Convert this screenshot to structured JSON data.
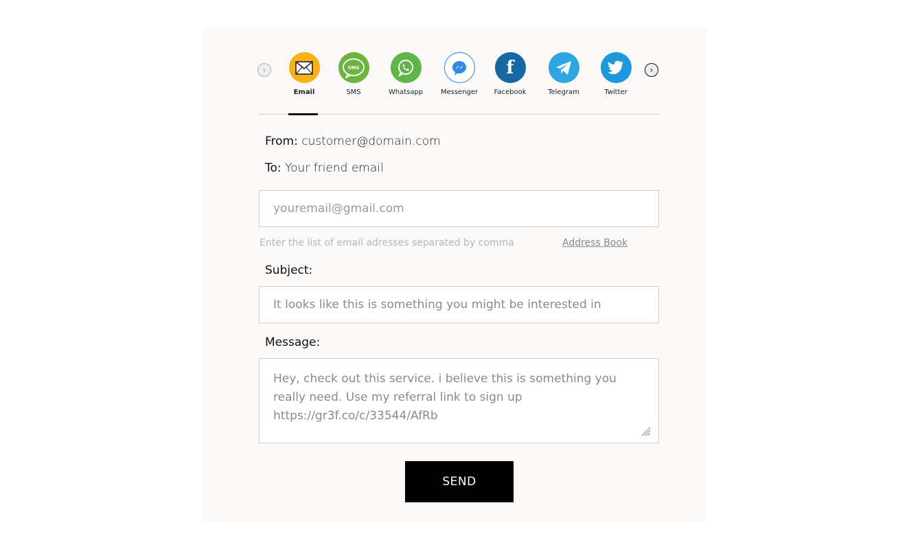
{
  "share": {
    "channels": [
      {
        "label": "Email",
        "icon": "envelope-icon",
        "color": "#fbb116",
        "active": true
      },
      {
        "label": "SMS",
        "icon": "sms-bubble-icon",
        "color": "#6cb33f",
        "badge": "SMS"
      },
      {
        "label": "Whatsapp",
        "icon": "whatsapp-icon",
        "color": "#5fb548"
      },
      {
        "label": "Messenger",
        "icon": "messenger-icon",
        "color": "#ffffff"
      },
      {
        "label": "Facebook",
        "icon": "facebook-icon",
        "color": "#1568a3",
        "glyph": "f"
      },
      {
        "label": "Telegram",
        "icon": "telegram-icon",
        "color": "#2fa6e0"
      },
      {
        "label": "Twitter",
        "icon": "twitter-icon",
        "color": "#1d98dc"
      }
    ],
    "prev_icon": "‹",
    "next_icon": "›"
  },
  "form": {
    "from_label": "From:",
    "from_value": "customer@domain.com",
    "to_label": "To:",
    "to_value": "Your friend email",
    "recipients_placeholder": "youremail@gmail.com",
    "hint": "Enter the list of email adresses separated by comma",
    "address_book_link": "Address Book",
    "subject_label": "Subject:",
    "subject_value": "It looks like this is something you might be interested in",
    "message_label": "Message:",
    "message_value": "Hey, check out this service. i believe this is something you\nreally need. Use my referral link to sign up\nhttps://gr3f.co/c/33544/AfRb",
    "send_label": "SEND"
  }
}
